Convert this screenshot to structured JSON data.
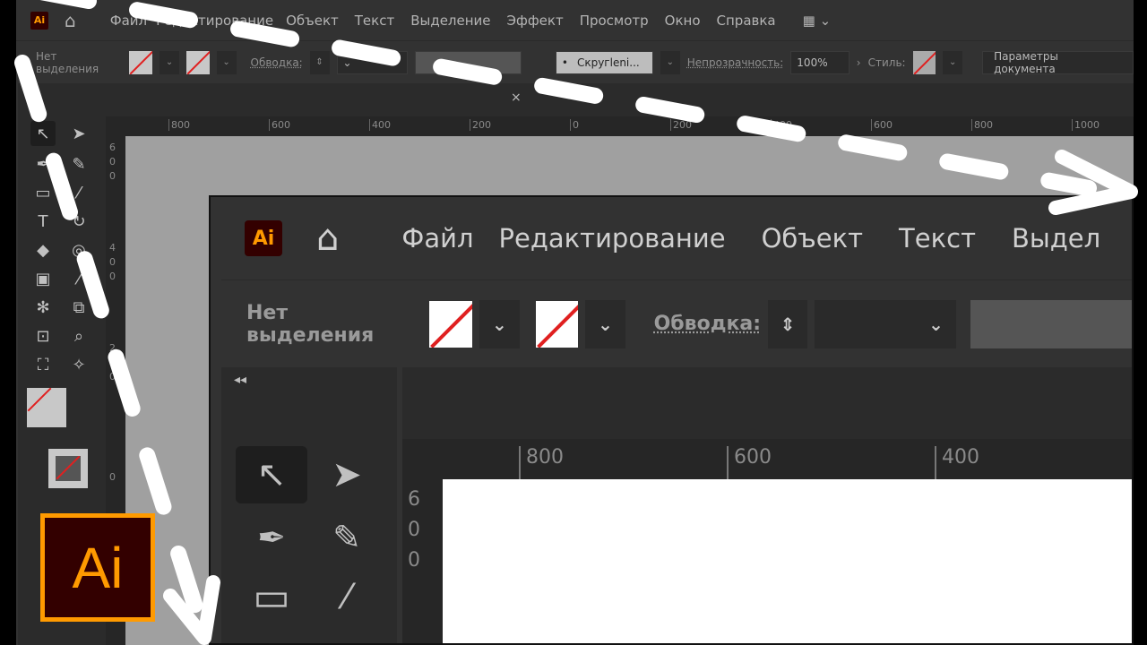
{
  "app": {
    "logo_text": "Ai"
  },
  "menu": [
    "Файл",
    "Редактирование",
    "Объект",
    "Текст",
    "Выделение",
    "Эффект",
    "Просмотр",
    "Окно",
    "Справка"
  ],
  "control_bar": {
    "selection": "Нет выделения",
    "stroke_label": "Обводка:",
    "brush": "Скругleni...",
    "opacity_label": "Непрозрачность:",
    "opacity_value": "100%",
    "style_label": "Стиль:",
    "doc_settings": "Параметры документа"
  },
  "panel": {
    "close": "×"
  },
  "ruler_top": [
    "800",
    "600",
    "400",
    "200",
    "0",
    "200",
    "400",
    "600",
    "800",
    "1000"
  ],
  "ruler_left": [
    "6",
    "0",
    "0",
    "4",
    "0",
    "0",
    "2",
    "0",
    "0",
    "0"
  ],
  "inset": {
    "menu": [
      "Файл",
      "Редактирование",
      "Объект",
      "Текст",
      "Выдел"
    ],
    "selection": "Нет выделения",
    "stroke_label": "Обводка:",
    "ruler_top": [
      "800",
      "600",
      "400"
    ],
    "ruler_left": [
      "6",
      "0",
      "0"
    ],
    "collapse": "◂◂"
  },
  "badge": {
    "text": "Ai"
  },
  "colors": {
    "accent": "#ff9a00",
    "ui_bg": "#323232",
    "canvas": "#a0a0a0"
  }
}
